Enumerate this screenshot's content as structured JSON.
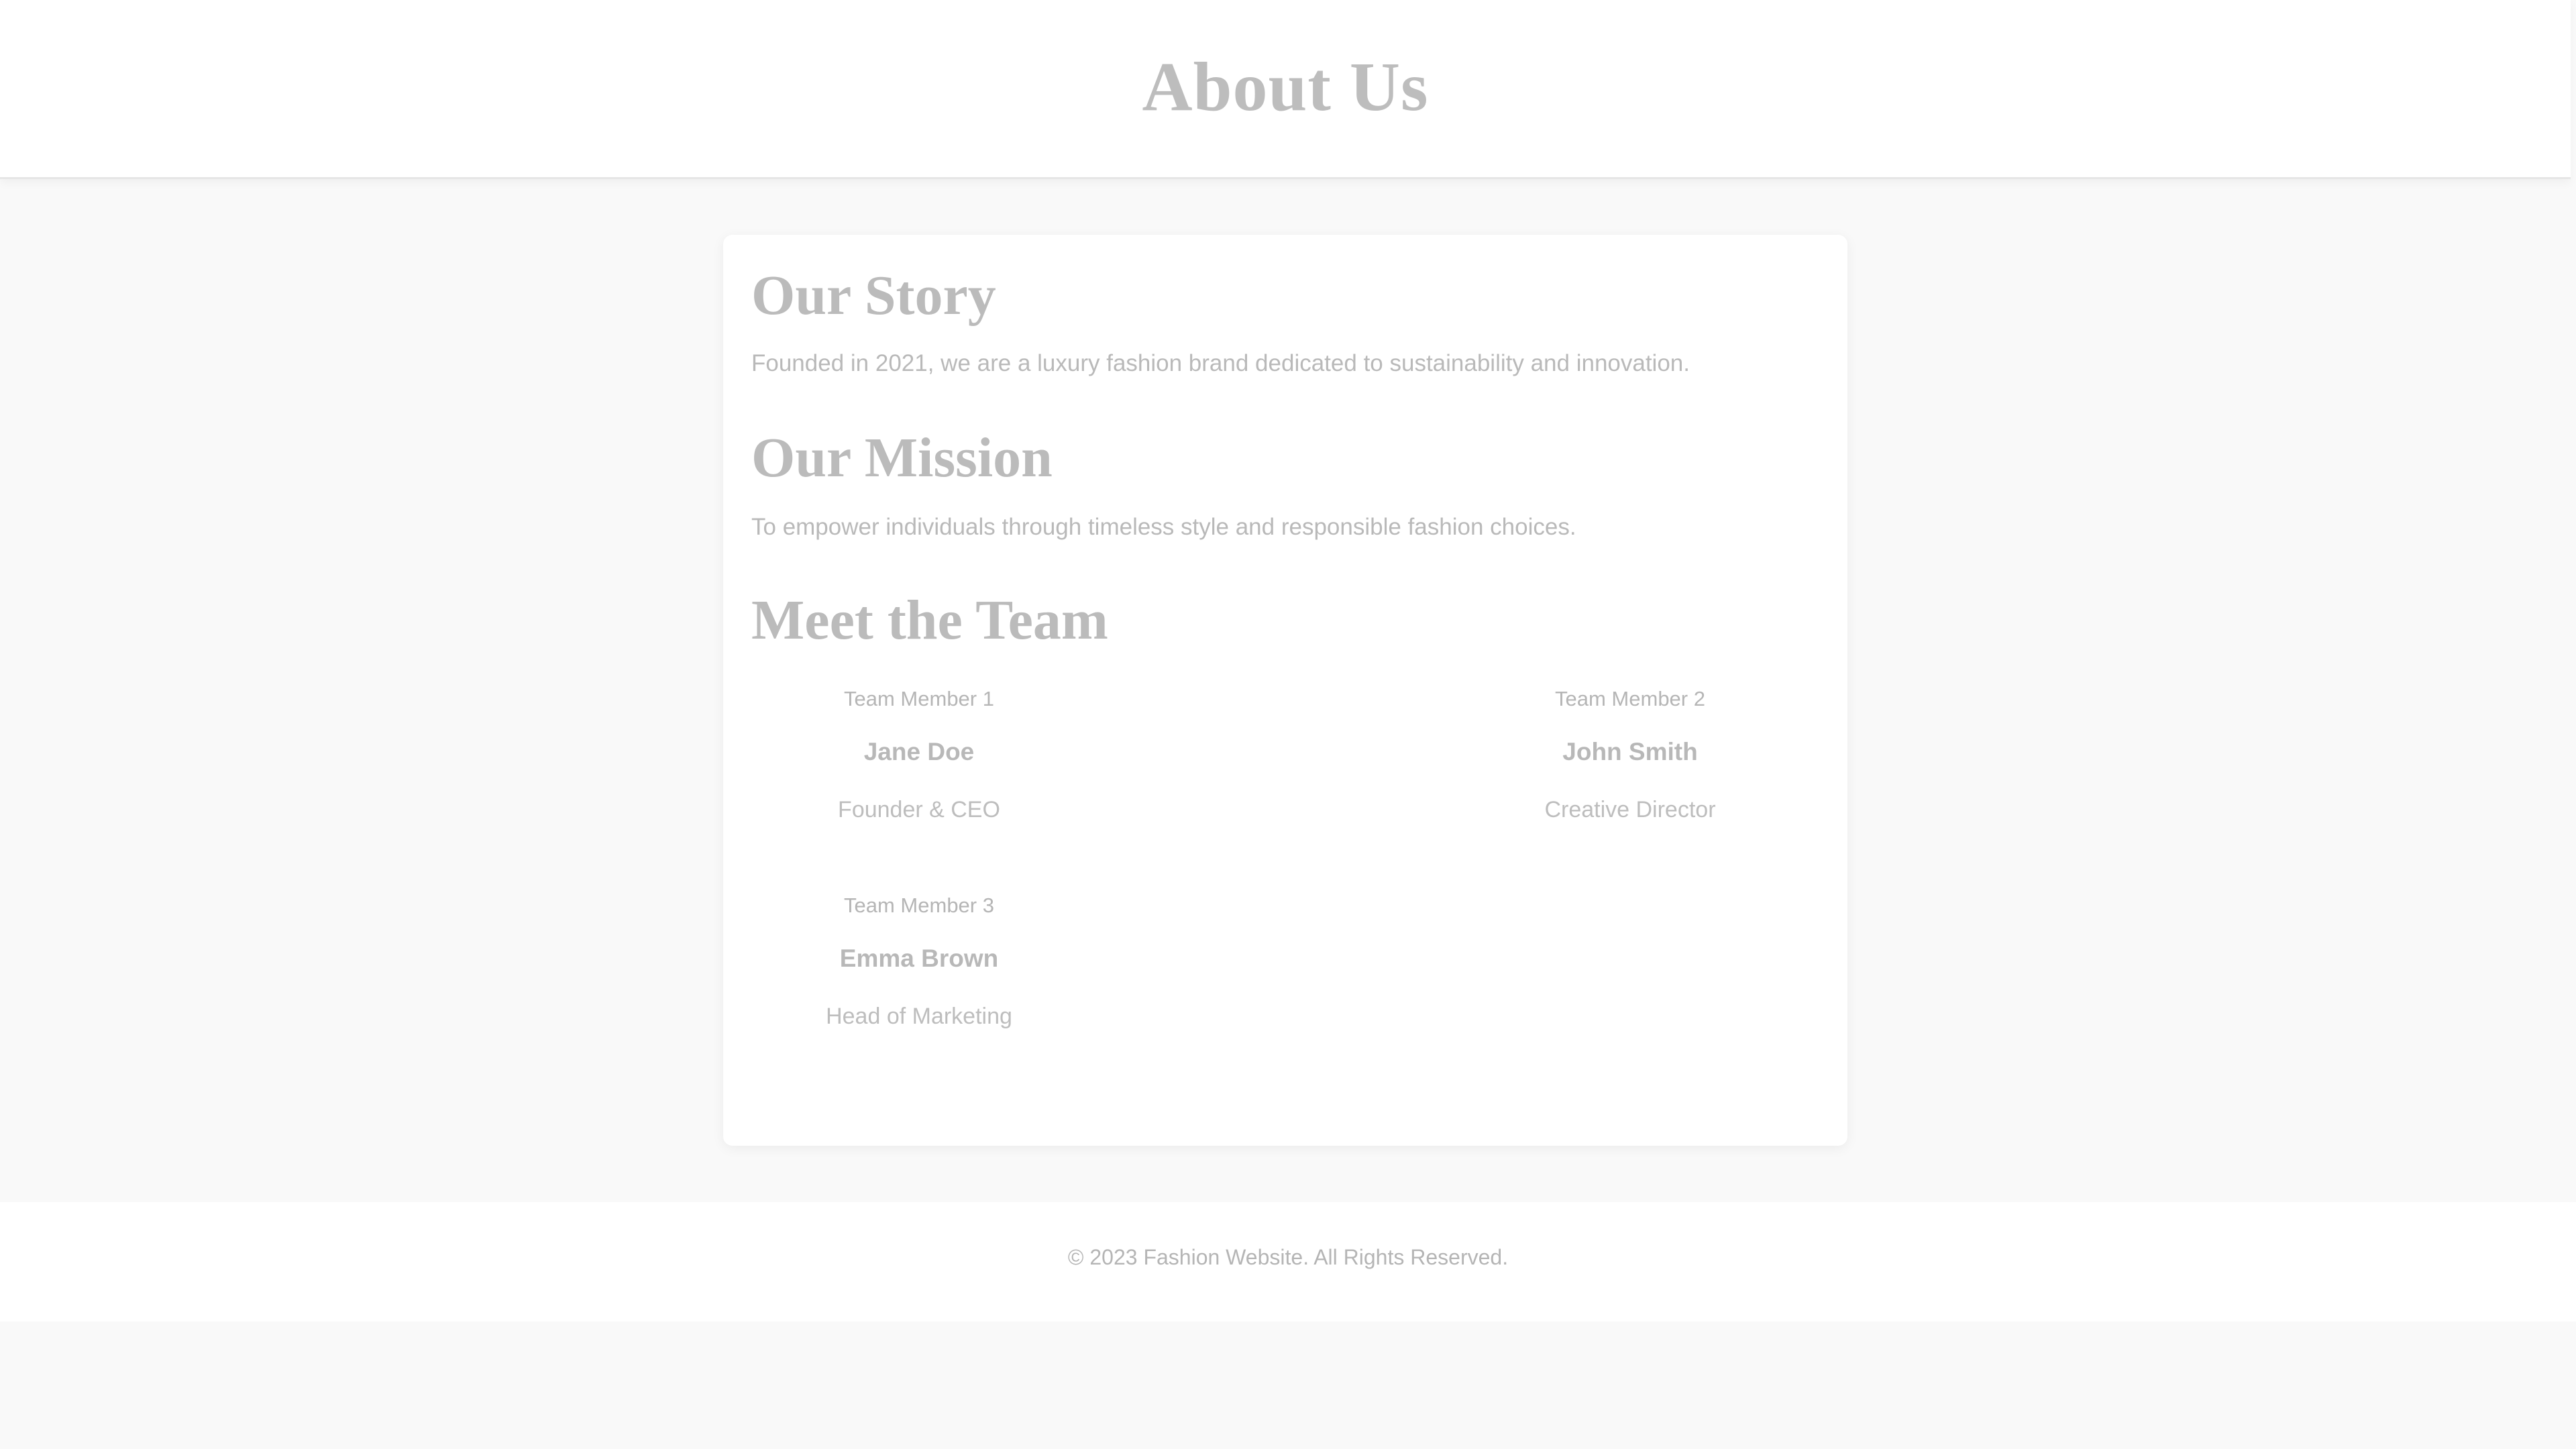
{
  "header": {
    "title": "About Us"
  },
  "story": {
    "heading": "Our Story",
    "text": "Founded in 2021, we are a luxury fashion brand dedicated to sustainability and innovation."
  },
  "mission": {
    "heading": "Our Mission",
    "text": "To empower individuals through timeless style and responsible fashion choices."
  },
  "team": {
    "heading": "Meet the Team",
    "members": [
      {
        "photo_alt": "Team Member 1",
        "name": "Jane Doe",
        "role": "Founder & CEO"
      },
      {
        "photo_alt": "Team Member 2",
        "name": "John Smith",
        "role": "Creative Director"
      },
      {
        "photo_alt": "Team Member 3",
        "name": "Emma Brown",
        "role": "Head of Marketing"
      }
    ]
  },
  "footer": {
    "text": "© 2023 Fashion Website. All Rights Reserved."
  }
}
